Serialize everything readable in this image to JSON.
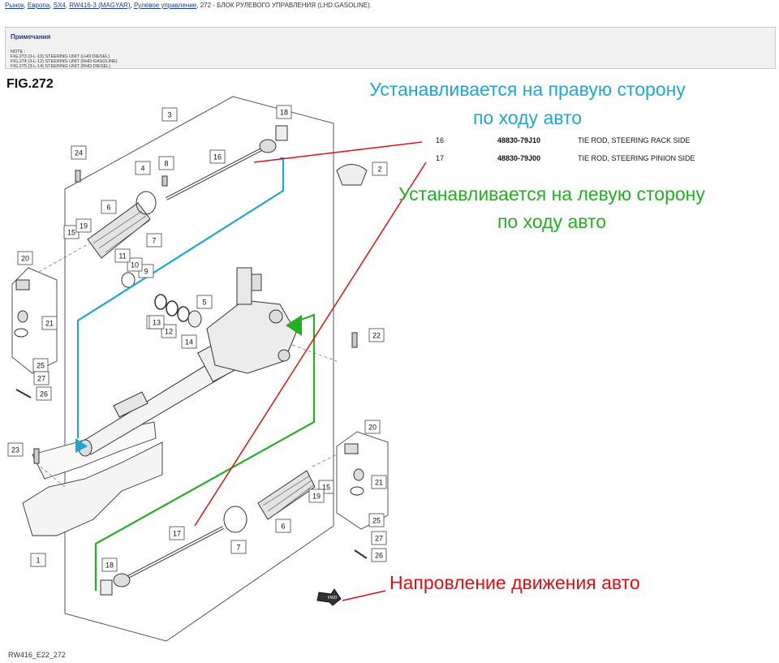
{
  "breadcrumb": {
    "items": [
      "Рынок",
      "Европа",
      "SX4",
      "RW416-3 (MAGYAR)",
      "Рулевое управление"
    ],
    "current": "272 - БЛОК РУЛЕВОГО УПРАВЛЕНИЯ (LHD:GASOLINE)"
  },
  "notes": {
    "title": "Примечания",
    "lines": [
      "NOTE :",
      "FIG.273 (3-L-10) STEERING UNIT (LHD:DIESEL)",
      "FIG.274 (3-L-12) STEERING UNIT (RHD:GASOLINE)",
      "FIG.275 (3-L-14) STEERING UNIT (RHD:DIESEL)"
    ]
  },
  "figure": {
    "title": "FIG.272",
    "footer_code": "RW416_E22_272"
  },
  "parts": [
    {
      "no": "16",
      "part_number": "48830-79J10",
      "name": "TIE ROD, STEERING RACK SIDE"
    },
    {
      "no": "17",
      "part_number": "48830-79J00",
      "name": "TIE ROD, STEERING PINION SIDE"
    }
  ],
  "annotations": {
    "right_side_line1": "Устанавливается на правую сторону",
    "right_side_line2": "по ходу авто",
    "left_side_line1": "Устанавливается на левую сторону",
    "left_side_line2": "по ходу авто",
    "direction": "Напровление движения авто"
  },
  "callouts": [
    "1",
    "2",
    "3",
    "4",
    "5",
    "6",
    "6",
    "7",
    "7",
    "8",
    "9",
    "10",
    "11",
    "12",
    "13",
    "13",
    "14",
    "15",
    "15",
    "16",
    "17",
    "18",
    "18",
    "19",
    "19",
    "20",
    "20",
    "21",
    "21",
    "22",
    "23",
    "24",
    "25",
    "25",
    "26",
    "26",
    "27",
    "27"
  ],
  "fwd_label": "FWD",
  "colors": {
    "blue": "#1fa6d8",
    "green": "#22b022",
    "red": "#e01010",
    "link": "#1a3d8f"
  }
}
